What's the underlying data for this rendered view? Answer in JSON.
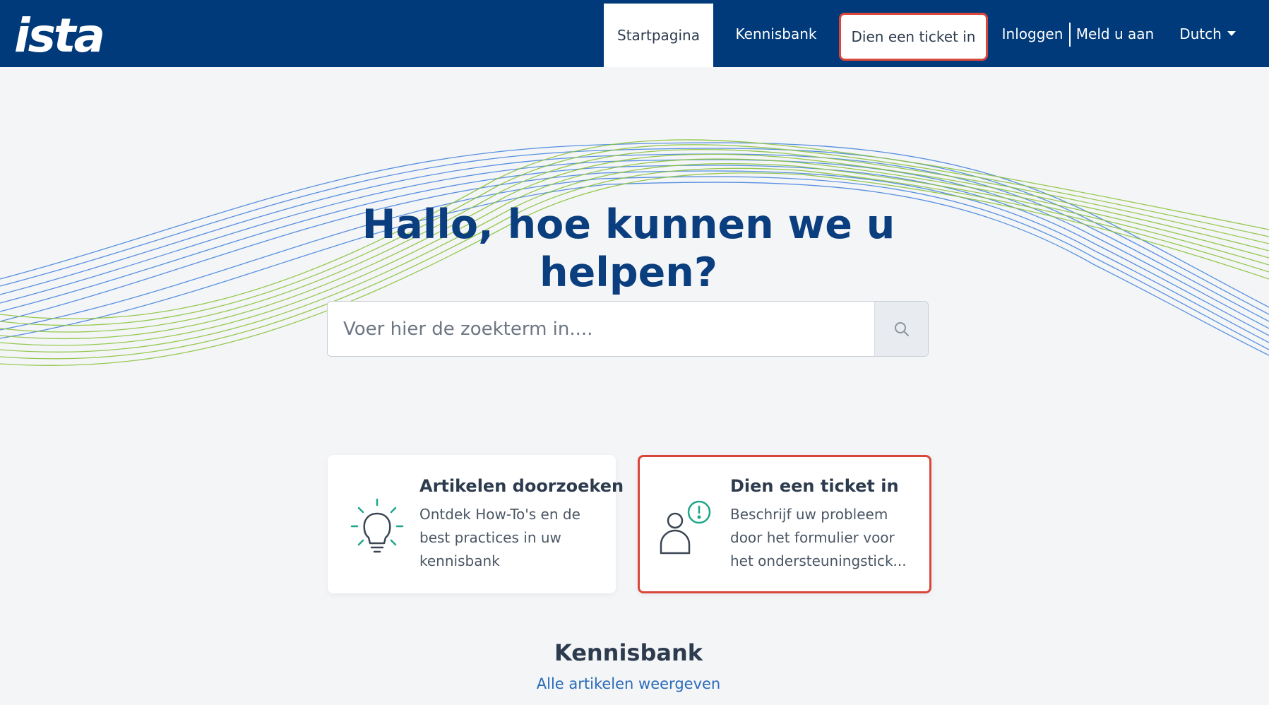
{
  "brand": {
    "logo_text": "ista"
  },
  "nav": {
    "home": "Startpagina",
    "knowledge_base": "Kennisbank",
    "submit_ticket": "Dien een ticket in",
    "login": "Inloggen",
    "signup": "Meld u aan",
    "language": "Dutch"
  },
  "hero": {
    "title": "Hallo, hoe kunnen we u helpen?",
    "search_placeholder": "Voer hier de zoekterm in...."
  },
  "cards": [
    {
      "title": "Artikelen doorzoeken",
      "description": "Ontdek How-To's en de best practices in uw kennisbank",
      "icon": "lightbulb-icon"
    },
    {
      "title": "Dien een ticket in",
      "lines": [
        "Beschrijf uw probleem",
        "door het formulier voor",
        "het ondersteuningstick..."
      ],
      "icon": "user-alert-icon"
    }
  ],
  "knowledge_base": {
    "title": "Kennisbank",
    "link": "Alle artikelen weergeven"
  },
  "colors": {
    "header_bg": "#003a7a",
    "accent_red": "#d9473b",
    "wave_green": "#8cc43f",
    "wave_blue": "#3d7fdc",
    "icon_green": "#1fa58a"
  }
}
